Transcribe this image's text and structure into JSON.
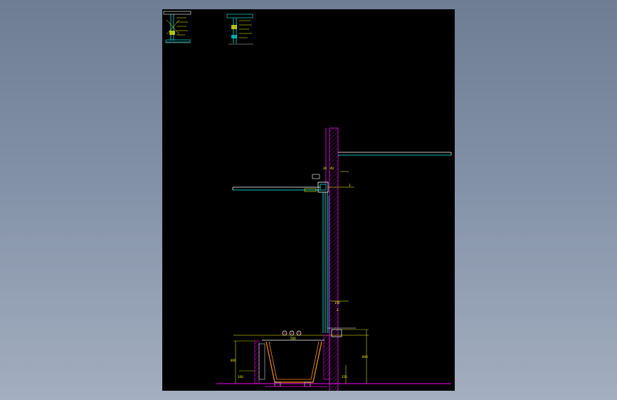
{
  "colors": {
    "background_top": "#6f7d94",
    "background_bottom": "#a3aebf",
    "sheet": "#000000",
    "wall_hatch": "#ff00ff",
    "structure": "#00ffff",
    "dimension": "#ffff00",
    "fixture": "#ff8c00",
    "outline": "#ffffff",
    "marker": "#ff0000"
  },
  "detail_thumbnails": [
    {
      "name": "ceiling-detail-1"
    },
    {
      "name": "ceiling-detail-2"
    }
  ],
  "dimension_labels": {
    "top_a": "20",
    "top_b": "40",
    "mid_right": "3",
    "lower_a": "150",
    "lower_b": "2",
    "basin_width": "500",
    "right_height": "800",
    "right_low": "150",
    "left_height": "800",
    "left_low": "100"
  },
  "icons": {
    "faucet_symbols": "faucet-symbols-icon",
    "wall_hatch": "wall-hatch-icon"
  }
}
